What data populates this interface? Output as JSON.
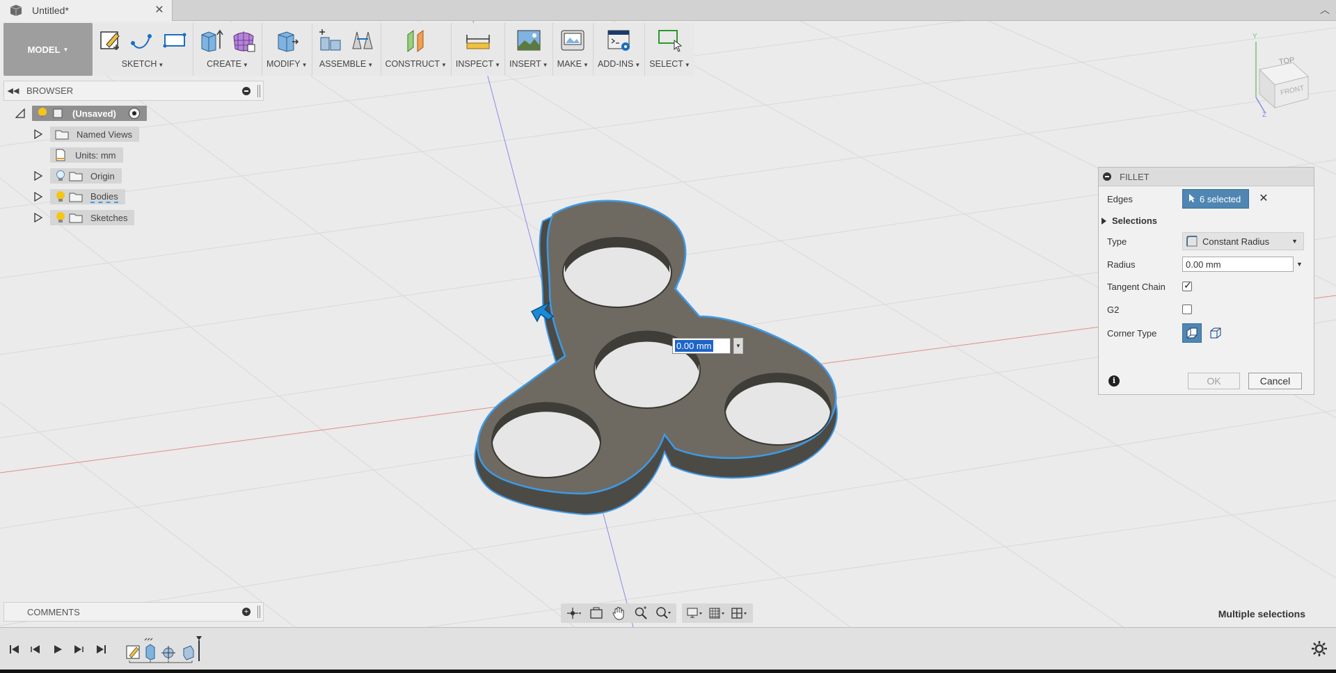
{
  "document": {
    "tab_title": "Untitled*"
  },
  "toolbar": {
    "workspace": "MODEL",
    "groups": [
      {
        "label": "SKETCH"
      },
      {
        "label": "CREATE"
      },
      {
        "label": "MODIFY"
      },
      {
        "label": "ASSEMBLE"
      },
      {
        "label": "CONSTRUCT"
      },
      {
        "label": "INSPECT"
      },
      {
        "label": "INSERT"
      },
      {
        "label": "MAKE"
      },
      {
        "label": "ADD-INS"
      },
      {
        "label": "SELECT"
      }
    ]
  },
  "browser": {
    "title": "BROWSER",
    "root": "(Unsaved)",
    "items": [
      {
        "label": "Named Views"
      },
      {
        "label": "Units: mm"
      },
      {
        "label": "Origin"
      },
      {
        "label": "Bodies"
      },
      {
        "label": "Sketches"
      }
    ]
  },
  "viewcube": {
    "top": "TOP",
    "front": "FRONT",
    "axis_y": "Y",
    "axis_z": "Z"
  },
  "canvas_input": {
    "value": "0.00 mm"
  },
  "fillet": {
    "title": "FILLET",
    "edges_label": "Edges",
    "edges_value": "6 selected",
    "selections_label": "Selections",
    "type_label": "Type",
    "type_value": "Constant Radius",
    "radius_label": "Radius",
    "radius_value": "0.00 mm",
    "tangent_chain_label": "Tangent Chain",
    "tangent_chain_checked": true,
    "g2_label": "G2",
    "g2_checked": false,
    "corner_type_label": "Corner Type",
    "ok_label": "OK",
    "cancel_label": "Cancel"
  },
  "comments": {
    "title": "COMMENTS"
  },
  "status": {
    "text": "Multiple selections"
  },
  "colors": {
    "selection_blue": "#3d9ae8",
    "model_body": "#6e6a61",
    "accent": "#4f86b3"
  }
}
